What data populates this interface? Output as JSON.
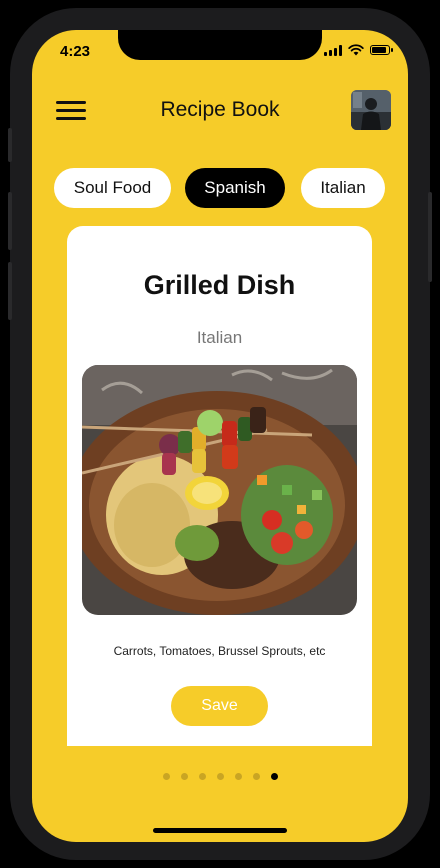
{
  "status_bar": {
    "time": "4:23",
    "battery_level": 0.9
  },
  "header": {
    "title": "Recipe Book",
    "menu_icon": "hamburger-icon",
    "avatar_icon": "user-avatar"
  },
  "categories": [
    {
      "label": "Soul Food",
      "selected": false
    },
    {
      "label": "Spanish",
      "selected": true
    },
    {
      "label": "Italian",
      "selected": false
    }
  ],
  "recipe_card": {
    "title": "Grilled Dish",
    "cuisine": "Italian",
    "ingredients": "Carrots, Tomatoes, Brussel Sprouts, etc",
    "save_label": "Save"
  },
  "pagination": {
    "count": 7,
    "active_index": 6
  },
  "colors": {
    "accent": "#F6CC29",
    "active_chip": "#000000",
    "inactive_chip": "#FFFFFF"
  }
}
